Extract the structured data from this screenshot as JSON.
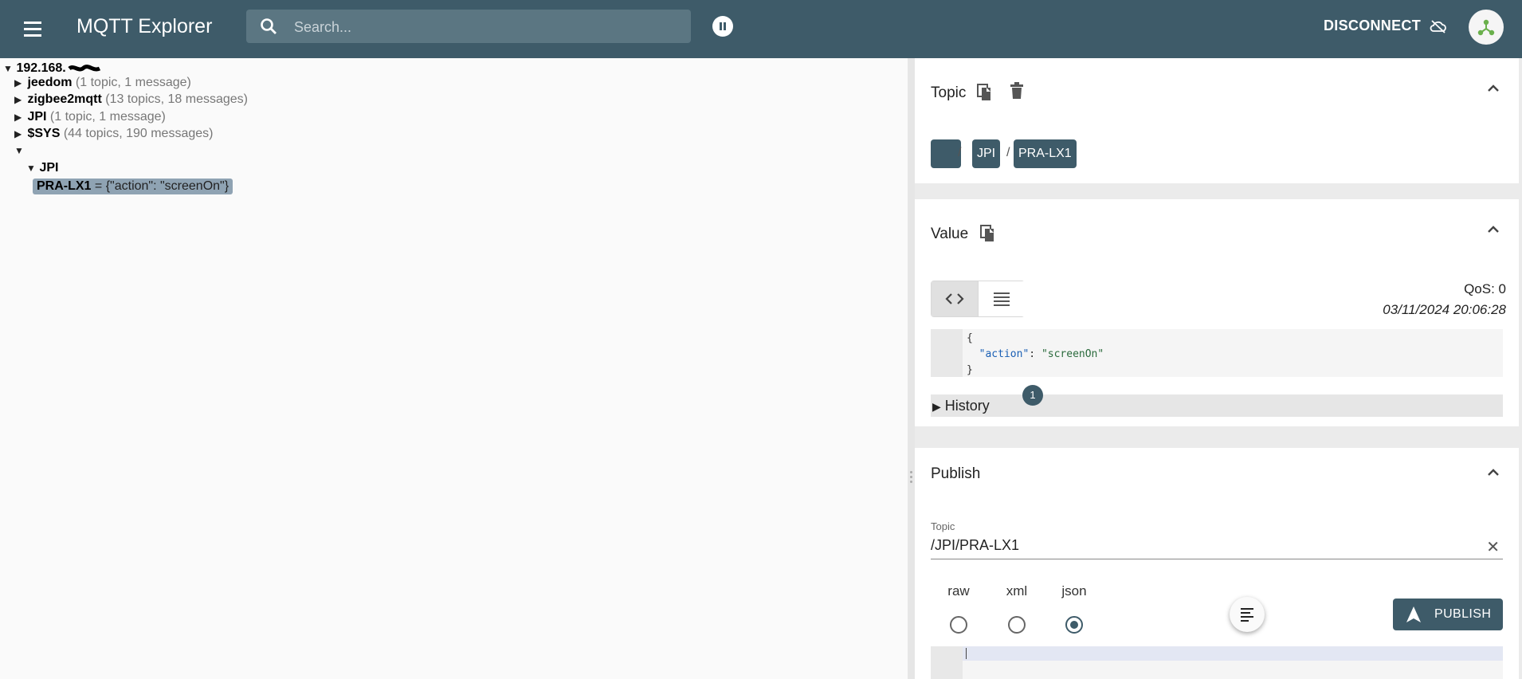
{
  "app": {
    "title": "MQTT Explorer"
  },
  "search": {
    "placeholder": "Search..."
  },
  "header": {
    "disconnect_label": "DISCONNECT"
  },
  "tree": {
    "root": "192.168.",
    "items": [
      {
        "name": "jeedom",
        "meta": "(1 topic, 1 message)"
      },
      {
        "name": "zigbee2mqtt",
        "meta": "(13 topics, 18 messages)"
      },
      {
        "name": "JPI",
        "meta": "(1 topic, 1 message)"
      },
      {
        "name": "$SYS",
        "meta": "(44 topics, 190 messages)"
      }
    ],
    "empty_node": "",
    "child": "JPI",
    "selected": {
      "name": "PRA-LX1",
      "value": "= {\"action\": \"screenOn\"}"
    }
  },
  "topic_panel": {
    "title": "Topic",
    "breadcrumbs": [
      "",
      "JPI",
      "PRA-LX1"
    ],
    "separator": "/"
  },
  "value_panel": {
    "title": "Value",
    "qos": "QoS: 0",
    "timestamp": "03/11/2024 20:06:28",
    "code_lines": [
      "{",
      "\"action\": \"screenOn\"",
      "}"
    ],
    "code_key": "\"action\"",
    "code_val": "\"screenOn\"",
    "history_label": "History",
    "history_count": "1"
  },
  "publish_panel": {
    "title": "Publish",
    "topic_label": "Topic",
    "topic_value": "/JPI/PRA-LX1",
    "formats": [
      "raw",
      "xml",
      "json"
    ],
    "selected_format": "json",
    "publish_label": "PUBLISH"
  },
  "colors": {
    "primary": "#3e5b69",
    "selected_bg": "#8fa3b3",
    "background": "#fafafa"
  }
}
